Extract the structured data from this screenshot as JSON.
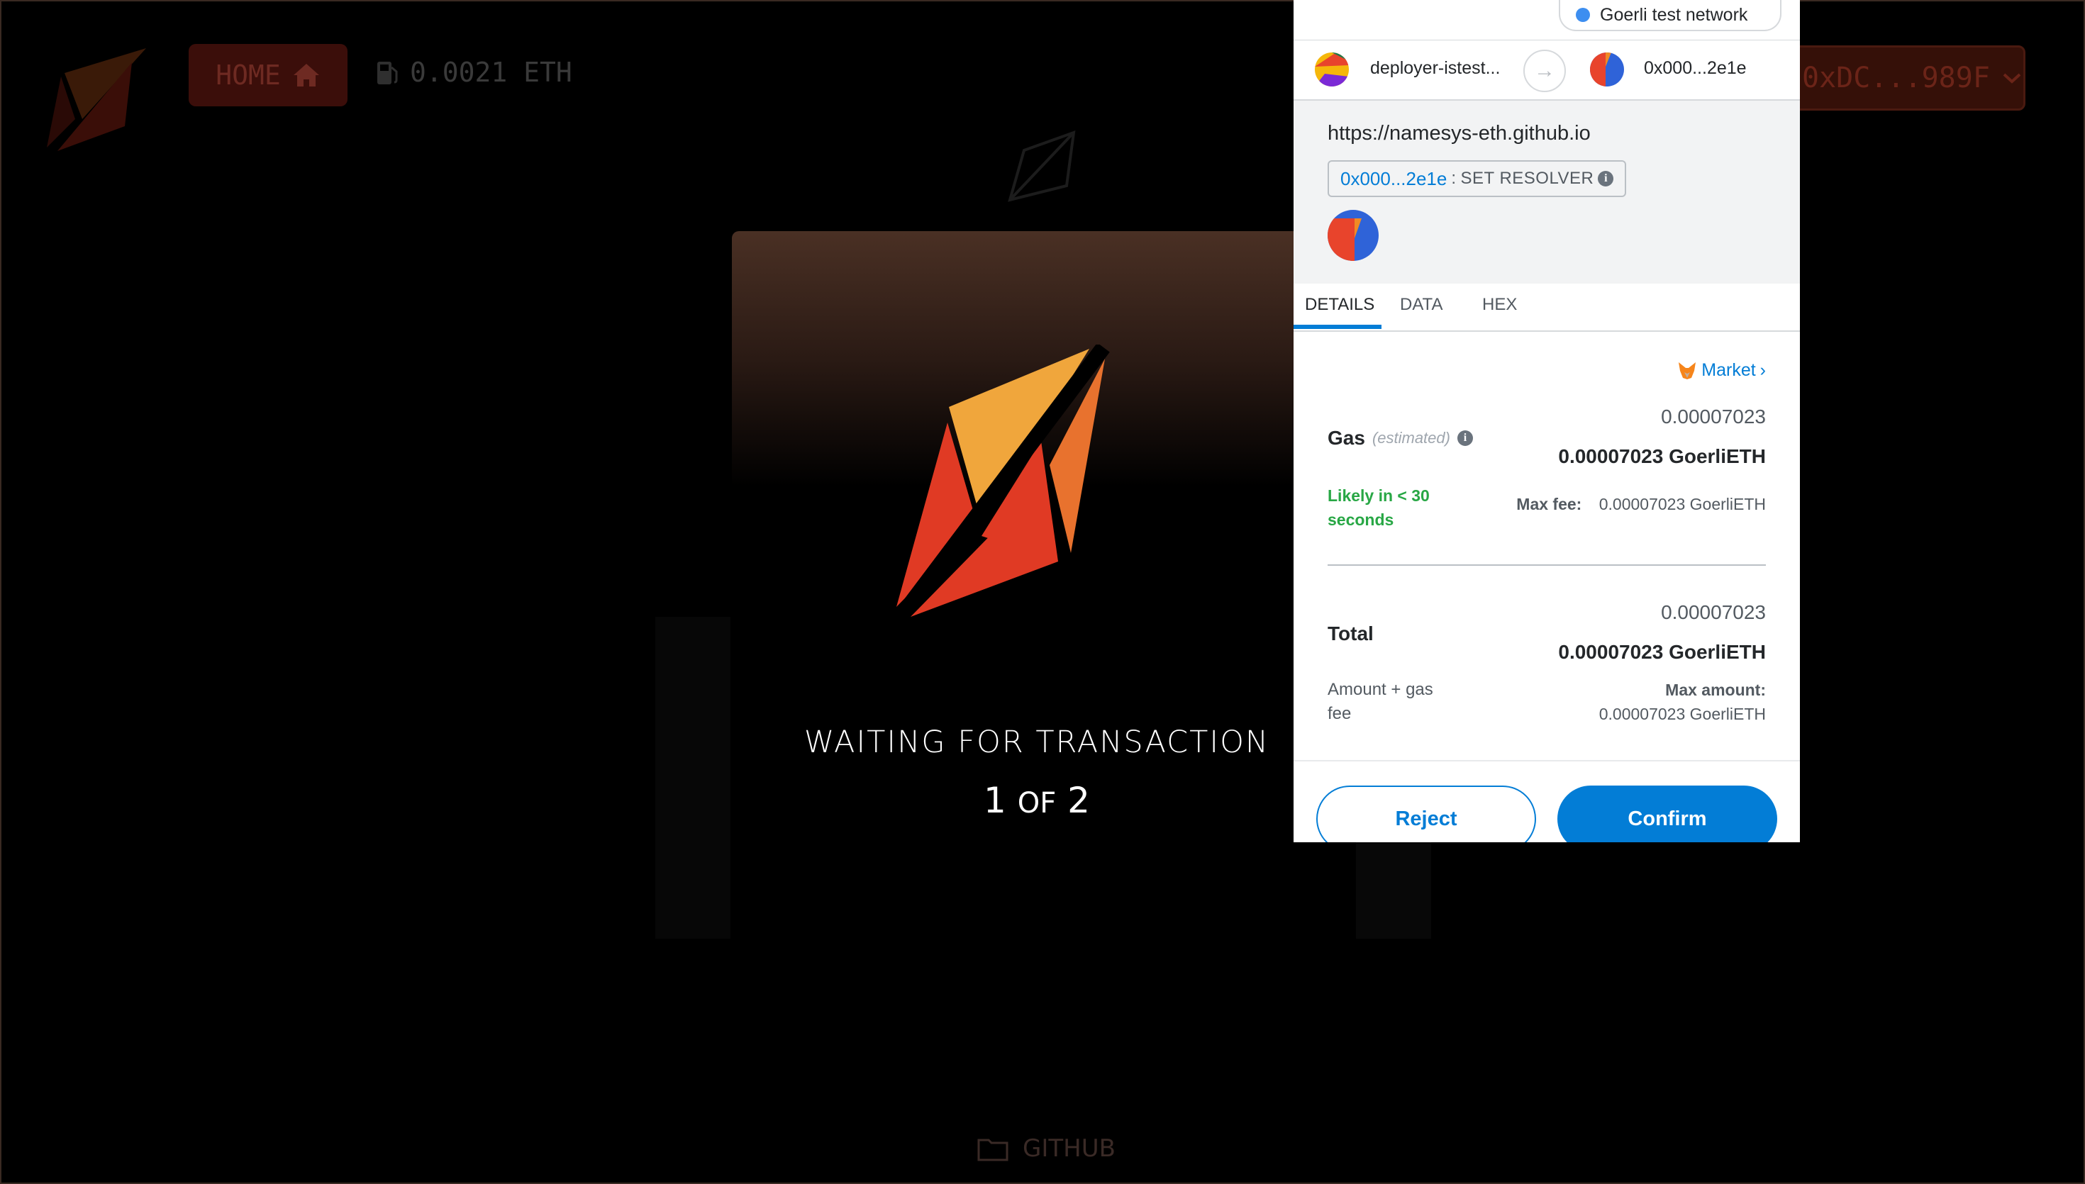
{
  "app": {
    "home_label": "HOME",
    "balance": "0.0021 ETH",
    "wallet_label": "0xDC...989F",
    "waiting_text": "WAITING FOR TRANSACTION",
    "step_current": "1",
    "step_of": "OF",
    "step_total": "2",
    "github_label": "GITHUB",
    "colors": {
      "brand_orange": "#f0a63c",
      "brand_red": "#e03a24",
      "brand_dark_orange": "#e8722e"
    }
  },
  "metamask": {
    "network": "Goerli test network",
    "from_account": "deployer-istest...",
    "to_account": "0x000...2e1e",
    "origin": "https://namesys-eth.github.io",
    "method_address": "0x000...2e1e",
    "method_separator": ":",
    "method_name": "SET RESOLVER",
    "tabs": [
      "DETAILS",
      "DATA",
      "HEX"
    ],
    "market_label": "Market",
    "gas": {
      "label": "Gas",
      "estimated": "(estimated)",
      "secondary": "0.00007023",
      "primary": "0.00007023 GoerliETH",
      "likely": "Likely in < 30 seconds",
      "max_fee_label": "Max fee:",
      "max_fee_value": "0.00007023 GoerliETH"
    },
    "total": {
      "label": "Total",
      "secondary": "0.00007023",
      "primary": "0.00007023 GoerliETH",
      "amount_gas_label": "Amount + gas fee",
      "max_amount_label": "Max amount:",
      "max_amount_value": "0.00007023 GoerliETH"
    },
    "reject_label": "Reject",
    "confirm_label": "Confirm",
    "accent": "#037dd6"
  }
}
